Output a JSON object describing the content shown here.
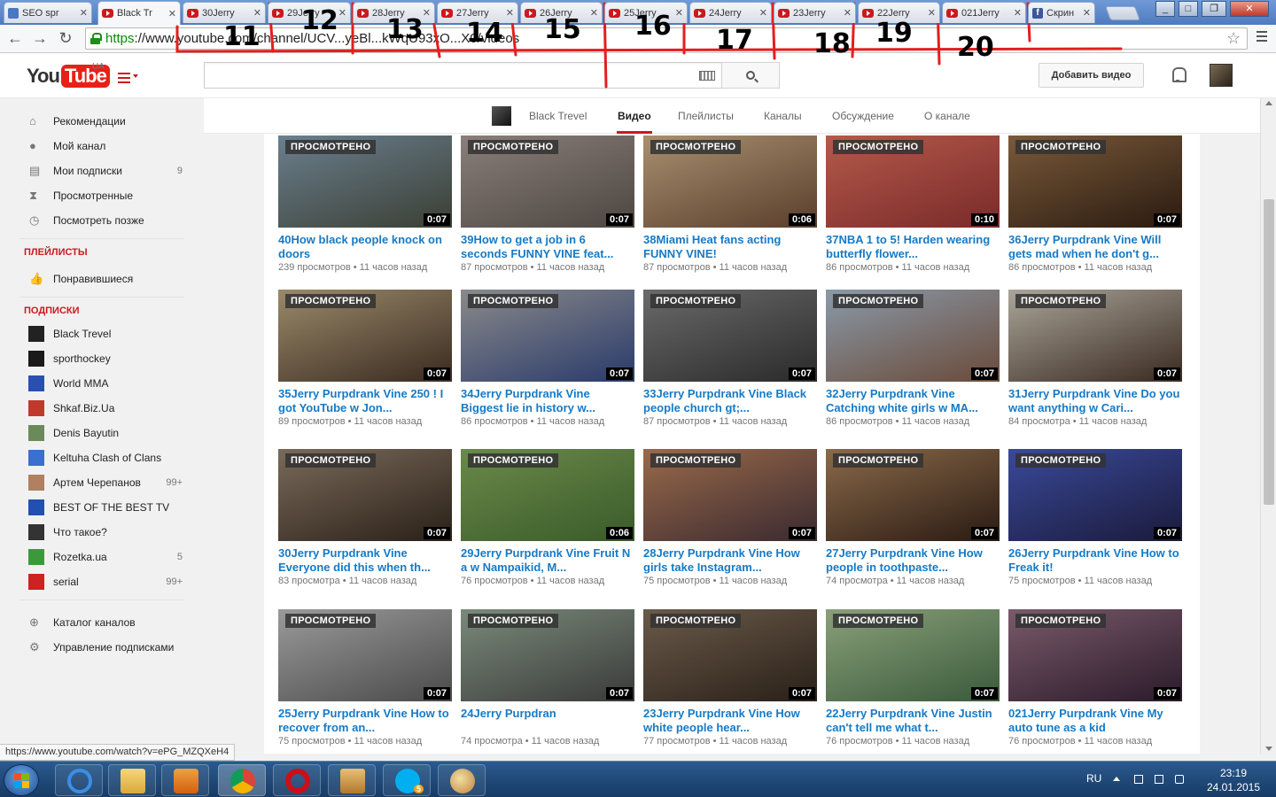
{
  "browser": {
    "tabs": [
      {
        "label": "SEO spr",
        "icon": "google-icon",
        "active": false
      },
      {
        "label": "Black Tr",
        "icon": "youtube-icon",
        "active": true
      },
      {
        "label": "30Jerry",
        "icon": "youtube-icon",
        "active": false
      },
      {
        "label": "29Jerry",
        "icon": "youtube-icon",
        "active": false
      },
      {
        "label": "28Jerry",
        "icon": "youtube-icon",
        "active": false
      },
      {
        "label": "27Jerry",
        "icon": "youtube-icon",
        "active": false
      },
      {
        "label": "26Jerry",
        "icon": "youtube-icon",
        "active": false
      },
      {
        "label": "25Jerry",
        "icon": "youtube-icon",
        "active": false
      },
      {
        "label": "24Jerry",
        "icon": "youtube-icon",
        "active": false
      },
      {
        "label": "23Jerry",
        "icon": "youtube-icon",
        "active": false
      },
      {
        "label": "22Jerry",
        "icon": "youtube-icon",
        "active": false
      },
      {
        "label": "021Jerry",
        "icon": "youtube-icon",
        "active": false
      },
      {
        "label": "Скрин",
        "icon": "facebook-icon",
        "active": false
      }
    ],
    "close_glyph": "✕",
    "url_https": "https",
    "url_rest": "://www.youtube.com/channel/UCV...yeBl...kWqU93xO...X0/videos",
    "status_url": "https://www.youtube.com/watch?v=ePG_MZQXeH4"
  },
  "annotations": [
    "11",
    "12",
    "13",
    "14",
    "15",
    "16",
    "17",
    "18",
    "19",
    "20"
  ],
  "header": {
    "logo_you": "You",
    "logo_tube": "Tube",
    "region": "UA",
    "upload_label": "Добавить видео"
  },
  "sidebar": {
    "main": [
      {
        "label": "Рекомендации",
        "icon": "home-icon"
      },
      {
        "label": "Мой канал",
        "icon": "user-icon"
      },
      {
        "label": "Мои подписки",
        "icon": "subscriptions-icon",
        "count": "9"
      },
      {
        "label": "Просмотренные",
        "icon": "history-icon"
      },
      {
        "label": "Посмотреть позже",
        "icon": "clock-icon"
      }
    ],
    "playlists_title": "ПЛЕЙЛИСТЫ",
    "playlists": [
      {
        "label": "Понравившиеся",
        "icon": "thumbs-up-icon"
      }
    ],
    "subs_title": "ПОДПИСКИ",
    "subs": [
      {
        "label": "Black Trevel",
        "count": "",
        "color": "#222222"
      },
      {
        "label": "sporthockey",
        "count": "",
        "color": "#1a1a1a"
      },
      {
        "label": "World MMA",
        "count": "",
        "color": "#2a4fb0"
      },
      {
        "label": "Shkaf.Biz.Ua",
        "count": "",
        "color": "#c0392b"
      },
      {
        "label": "Denis Bayutin",
        "count": "",
        "color": "#6b8a5a"
      },
      {
        "label": "Keltuha Clash of Clans",
        "count": "",
        "color": "#3b6fd0"
      },
      {
        "label": "Артем Черепанов",
        "count": "99+",
        "color": "#b08060"
      },
      {
        "label": "BEST OF THE BEST TV",
        "count": "",
        "color": "#2050b0"
      },
      {
        "label": "Что такое?",
        "count": "",
        "color": "#333333"
      },
      {
        "label": "Rozetka.ua",
        "count": "5",
        "color": "#3a9a3a"
      },
      {
        "label": "serial",
        "count": "99+",
        "color": "#cc2222"
      }
    ],
    "footer": [
      {
        "label": "Каталог каналов",
        "icon": "plus-circle-icon"
      },
      {
        "label": "Управление подписками",
        "icon": "gear-icon"
      }
    ]
  },
  "channel_nav": {
    "channel_name": "Black Trevel",
    "tabs": [
      "Видео",
      "Плейлисты",
      "Каналы",
      "Обсуждение",
      "О канале"
    ],
    "selected": "Видео"
  },
  "watched_label": "ПРОСМОТРЕНО",
  "videos": [
    {
      "title": "40How black people knock on doors",
      "views": "239 просмотров",
      "age": "11 часов назад",
      "duration": "0:07",
      "c1": "#6b7f8f",
      "c2": "#3a3f33"
    },
    {
      "title": "39How to get a job in 6 seconds FUNNY VINE feat...",
      "views": "87 просмотров",
      "age": "11 часов назад",
      "duration": "0:07",
      "c1": "#8a7f7a",
      "c2": "#4d4640"
    },
    {
      "title": "38Miami Heat fans acting FUNNY VINE!",
      "views": "87 просмотров",
      "age": "11 часов назад",
      "duration": "0:06",
      "c1": "#a89070",
      "c2": "#5a3e2c"
    },
    {
      "title": "37NBA 1 to 5! Harden wearing butterfly flower...",
      "views": "86 просмотров",
      "age": "11 часов назад",
      "duration": "0:10",
      "c1": "#b45a4a",
      "c2": "#7a2a2a"
    },
    {
      "title": "36Jerry Purpdrank Vine Will gets mad when he don't g...",
      "views": "86 просмотров",
      "age": "11 часов назад",
      "duration": "0:07",
      "c1": "#7a5a3a",
      "c2": "#2a1a10"
    },
    {
      "title": "35Jerry Purpdrank Vine 250 ! I got YouTube w Jon...",
      "views": "89 просмотров",
      "age": "11 часов назад",
      "duration": "0:07",
      "c1": "#9a8a6a",
      "c2": "#3a2a20"
    },
    {
      "title": "34Jerry Purpdrank Vine Biggest lie in history w...",
      "views": "86 просмотров",
      "age": "11 часов назад",
      "duration": "0:07",
      "c1": "#8a8a8a",
      "c2": "#2a3a6a"
    },
    {
      "title": "33Jerry Purpdrank Vine Black people church gt;...",
      "views": "87 просмотров",
      "age": "11 часов назад",
      "duration": "0:07",
      "c1": "#6a6a6a",
      "c2": "#2a2a2a"
    },
    {
      "title": "32Jerry Purpdrank Vine Catching white girls w MA...",
      "views": "86 просмотров",
      "age": "11 часов назад",
      "duration": "0:07",
      "c1": "#8a9aa8",
      "c2": "#6a4a3a"
    },
    {
      "title": "31Jerry Purpdrank Vine Do you want anything w Cari...",
      "views": "84 просмотра",
      "age": "11 часов назад",
      "duration": "0:07",
      "c1": "#aaa59a",
      "c2": "#3a2a20"
    },
    {
      "title": "30Jerry Purpdrank Vine Everyone did this when th...",
      "views": "83 просмотра",
      "age": "11 часов назад",
      "duration": "0:07",
      "c1": "#7a6a5a",
      "c2": "#2a2018"
    },
    {
      "title": "29Jerry Purpdrank Vine Fruit N a w Nampaikid, M...",
      "views": "76 просмотров",
      "age": "11 часов назад",
      "duration": "0:06",
      "c1": "#6a8a4a",
      "c2": "#3a5a2a"
    },
    {
      "title": "28Jerry Purpdrank Vine How girls take Instagram...",
      "views": "75 просмотров",
      "age": "11 часов назад",
      "duration": "0:07",
      "c1": "#9a6a4a",
      "c2": "#3a2a30"
    },
    {
      "title": "27Jerry Purpdrank Vine How people in toothpaste...",
      "views": "74 просмотра",
      "age": "11 часов назад",
      "duration": "0:07",
      "c1": "#8a6a4a",
      "c2": "#2a1a12"
    },
    {
      "title": "26Jerry Purpdrank Vine How to Freak it!",
      "views": "75 просмотров",
      "age": "11 часов назад",
      "duration": "0:07",
      "c1": "#3a4a9a",
      "c2": "#1a1a3a"
    },
    {
      "title": "25Jerry Purpdrank Vine How to recover from an...",
      "views": "75 просмотров",
      "age": "11 часов назад",
      "duration": "0:07",
      "c1": "#9a9a9a",
      "c2": "#4a4a4a"
    },
    {
      "title": "24Jerry Purpdran",
      "views": "74 просмотра",
      "age": "11 часов назад",
      "duration": "0:07",
      "c1": "#7a8a7a",
      "c2": "#3a3a3a"
    },
    {
      "title": "23Jerry Purpdrank Vine How white people hear...",
      "views": "77 просмотров",
      "age": "11 часов назад",
      "duration": "0:07",
      "c1": "#6a5a4a",
      "c2": "#2a2018"
    },
    {
      "title": "22Jerry Purpdrank Vine Justin can't tell me what t...",
      "views": "76 просмотров",
      "age": "11 часов назад",
      "duration": "0:07",
      "c1": "#8aa07a",
      "c2": "#3a5a3a"
    },
    {
      "title": "021Jerry Purpdrank Vine My auto tune as a kid",
      "views": "76 просмотров",
      "age": "11 часов назад",
      "duration": "0:07",
      "c1": "#7a5a6a",
      "c2": "#2a1a2a"
    }
  ],
  "taskbar": {
    "lang": "RU",
    "time": "23:19",
    "date": "24.01.2015",
    "apps": [
      "ie-icon",
      "explorer-icon",
      "media-player-icon",
      "chrome-icon",
      "opera-icon",
      "contacts-icon",
      "skype-icon",
      "paint-icon"
    ],
    "skype_badge": "5"
  }
}
